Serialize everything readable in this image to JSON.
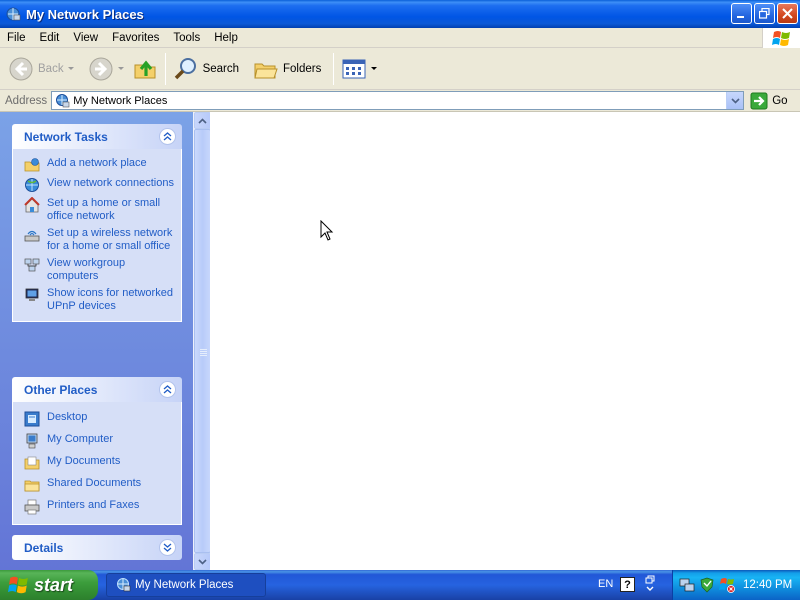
{
  "window": {
    "title": "My Network Places",
    "buttons": [
      "minimize",
      "restore",
      "close"
    ]
  },
  "menubar": {
    "items": [
      "File",
      "Edit",
      "View",
      "Favorites",
      "Tools",
      "Help"
    ]
  },
  "toolbar": {
    "back_label": "Back",
    "search_label": "Search",
    "folders_label": "Folders"
  },
  "addressbar": {
    "label": "Address",
    "value": "My Network Places",
    "go_label": "Go"
  },
  "taskpane": {
    "network_tasks": {
      "title": "Network Tasks",
      "items": [
        {
          "label": "Add a network place",
          "icon": "add-network-place-icon"
        },
        {
          "label": "View network connections",
          "icon": "network-connections-icon"
        },
        {
          "label": "Set up a home or small office network",
          "icon": "home-network-icon"
        },
        {
          "label": "Set up a wireless network for a home or small office",
          "icon": "wireless-network-icon"
        },
        {
          "label": "View workgroup computers",
          "icon": "workgroup-icon"
        },
        {
          "label": "Show icons for networked UPnP devices",
          "icon": "upnp-icon"
        }
      ]
    },
    "other_places": {
      "title": "Other Places",
      "items": [
        {
          "label": "Desktop",
          "icon": "desktop-icon"
        },
        {
          "label": "My Computer",
          "icon": "my-computer-icon"
        },
        {
          "label": "My Documents",
          "icon": "my-documents-icon"
        },
        {
          "label": "Shared Documents",
          "icon": "shared-documents-icon"
        },
        {
          "label": "Printers and Faxes",
          "icon": "printers-icon"
        }
      ]
    },
    "details": {
      "title": "Details"
    }
  },
  "taskbar": {
    "start_label": "start",
    "active_task": "My Network Places",
    "language": "EN",
    "help_glyph": "?",
    "clock": "12:40 PM"
  },
  "colors": {
    "titlebar_blue": "#0055e5",
    "taskpane_blue": "#7ba2e7",
    "task_link": "#215dc6",
    "start_green": "#3d9e3d"
  }
}
